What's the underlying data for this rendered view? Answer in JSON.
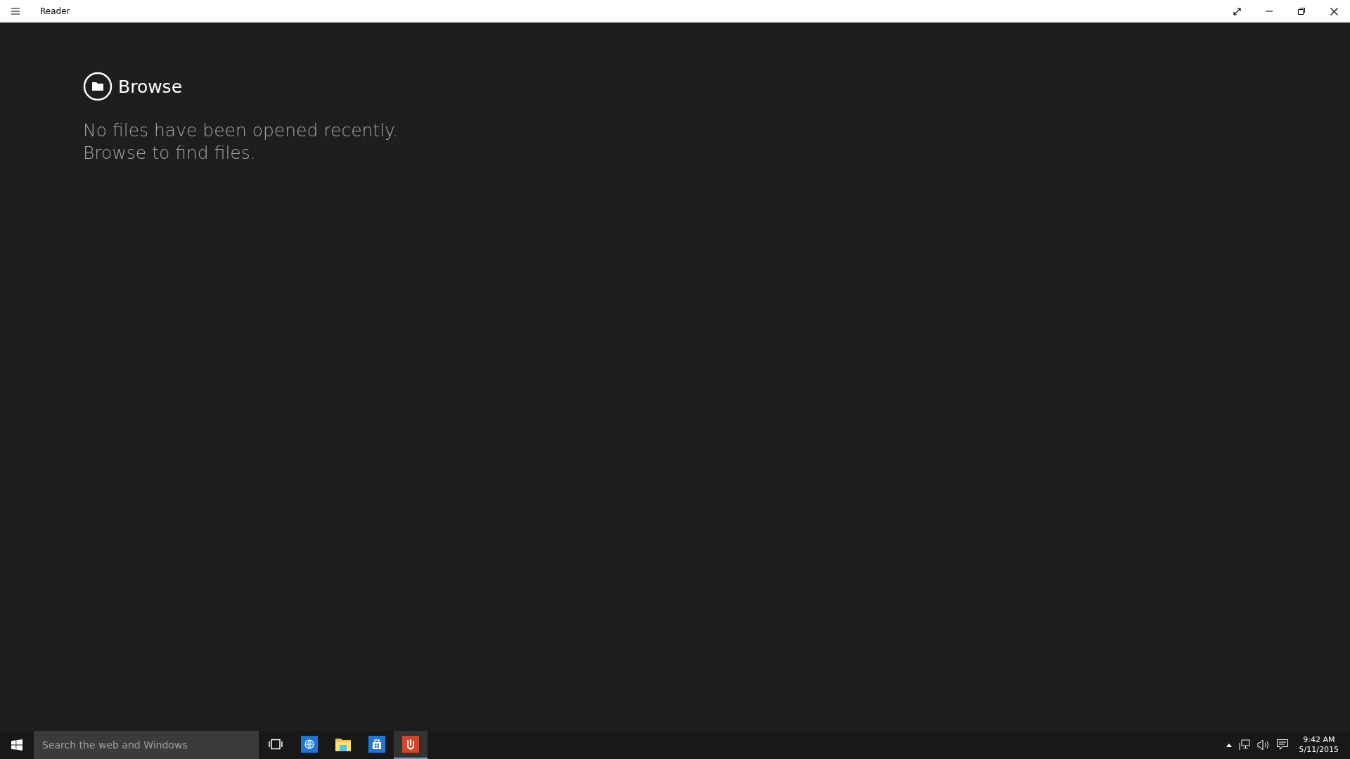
{
  "window": {
    "title": "Reader"
  },
  "browse": {
    "label": "Browse",
    "message": [
      "No files have been opened recently.",
      "Browse to find files."
    ]
  },
  "taskbar": {
    "search": {
      "placeholder": "Search the web and Windows"
    },
    "apps": [
      {
        "kind": "taskview",
        "active": false
      },
      {
        "kind": "browser",
        "active": false
      },
      {
        "kind": "explorer",
        "active": false
      },
      {
        "kind": "store",
        "active": false
      },
      {
        "kind": "reader",
        "active": true
      }
    ],
    "clock": {
      "time": "9:42 AM",
      "date": "5/11/2015"
    }
  }
}
